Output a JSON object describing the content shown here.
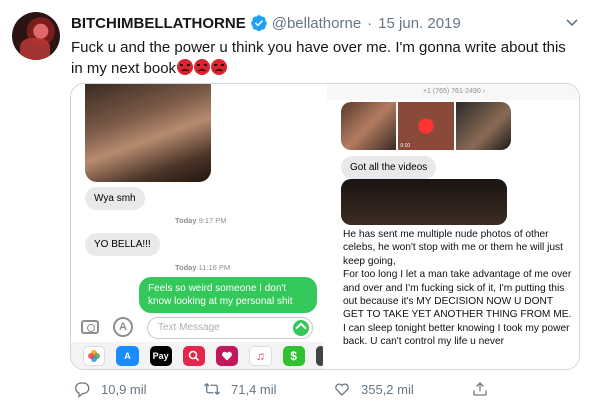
{
  "tweet": {
    "display_name": "BITCHIMBELLATHORNE",
    "handle": "@bellathorne",
    "separator": "·",
    "date": "15 jun. 2019",
    "text": "Fuck u and the power u think you have over me. I'm gonna write about this in my next book",
    "emoji": [
      "angry-face",
      "angry-face",
      "angry-face"
    ]
  },
  "left_screenshot": {
    "messages": [
      {
        "kind": "incoming",
        "text": "Wya smh"
      },
      {
        "kind": "timestamp",
        "day": "Today",
        "time": "9:17 PM"
      },
      {
        "kind": "incoming",
        "text": "YO BELLA!!!"
      },
      {
        "kind": "timestamp",
        "day": "Today",
        "time": "11:16 PM"
      },
      {
        "kind": "outgoing",
        "text": "Feels so weird someone I don't know looking at my personal shit"
      }
    ],
    "compose_placeholder": "Text Message",
    "tray_apps": [
      {
        "name": "photos-app",
        "label": "",
        "color": "#ffffff"
      },
      {
        "name": "app-store-app",
        "label": "A",
        "color": "#1a8cff"
      },
      {
        "name": "apple-pay-app",
        "label": "Pay",
        "color": "#000000"
      },
      {
        "name": "web-search-app",
        "label": "",
        "color": "#e3264a"
      },
      {
        "name": "heart-app",
        "label": "",
        "color": "#c2185b"
      },
      {
        "name": "music-app",
        "label": "♫",
        "color": "#ffffff"
      },
      {
        "name": "cash-app",
        "label": "$",
        "color": "#2ec230"
      },
      {
        "name": "more-app",
        "label": "",
        "color": "#444444"
      }
    ]
  },
  "right_screenshot": {
    "sender": "+1 (765) 761-2490 ›",
    "video_duration": "0:10",
    "incoming_text": "Got all the videos",
    "statement": [
      "He has sent me multiple nude photos of other celebs, he won't stop with me or them he will just keep going,",
      "For too long I let a man take advantage of me over and over and I'm fucking sick of it, I'm putting this out because it's MY DECISION NOW U DONT GET TO TAKE YET ANOTHER THING FROM ME.",
      "I can sleep tonight better knowing I took my power back. U can't control my life u never"
    ]
  },
  "actions": {
    "replies": "10,9 mil",
    "retweets": "71,4 mil",
    "likes": "355,2 mil"
  },
  "colors": {
    "verified": "#1da1f2",
    "imessage_green": "#34c759",
    "imessage_gray": "#e9e9eb",
    "secondary_text": "#657786"
  }
}
